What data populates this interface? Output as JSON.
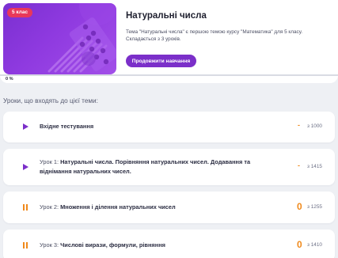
{
  "course": {
    "grade_badge": "5 клас",
    "title": "Натуральні числа",
    "description": "Тема \"Натуральні числа\" є першою темою курсу \"Математика\" для 5 класу. Складається з 3 уроків.",
    "continue_label": "Продовжити навчання",
    "progress_label": "0 %",
    "progress_fraction": 0
  },
  "section_title": "Уроки, що входять до цієї теми:",
  "lessons": [
    {
      "prefix": "",
      "name": "Вхідне тестування",
      "name_line2": "",
      "score": "-",
      "total": "з 1000",
      "state": "play",
      "icon_color": "#7b2fc9"
    },
    {
      "prefix": "Урок 1: ",
      "name": "Натуральні числа. Порівняння натуральних чисел. Додавання та",
      "name_line2": "віднімання натуральних чисел.",
      "score": "-",
      "total": "з 1415",
      "state": "play",
      "icon_color": "#7b2fc9"
    },
    {
      "prefix": "Урок 2: ",
      "name": "Множення і ділення натуральних чисел",
      "name_line2": "",
      "score": "0",
      "total": "з 1255",
      "state": "pause",
      "icon_color": "#f08a1c"
    },
    {
      "prefix": "Урок 3: ",
      "name": "Числові вирази, формули, рівняння",
      "name_line2": "",
      "score": "0",
      "total": "з 1410",
      "state": "pause",
      "icon_color": "#f08a1c"
    }
  ],
  "colors": {
    "accent": "#7b2fc9",
    "badge": "#e8385a",
    "score": "#f08a1c"
  }
}
